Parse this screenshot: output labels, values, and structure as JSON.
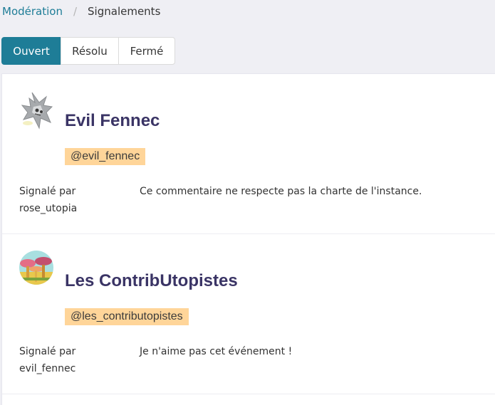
{
  "breadcrumb": {
    "parent": "Modération",
    "separator": "/",
    "current": "Signalements"
  },
  "tabs": [
    {
      "label": "Ouvert",
      "active": true
    },
    {
      "label": "Résolu",
      "active": false
    },
    {
      "label": "Fermé",
      "active": false
    }
  ],
  "reports": [
    {
      "display_name": "Evil Fennec",
      "handle": "@evil_fennec",
      "reported_by_label": "Signalé par",
      "reporter": "rose_utopia",
      "comment": "Ce commentaire ne respecte pas la charte de l'instance.",
      "avatar_icon": "fennec-avatar-icon"
    },
    {
      "display_name": "Les ContribUtopistes",
      "handle": "@les_contributopistes",
      "reported_by_label": "Signalé par",
      "reporter": "evil_fennec",
      "comment": "Je n'aime pas cet événement !",
      "avatar_icon": "mushroom-avatar-icon"
    }
  ],
  "colors": {
    "accent": "#1e7d97",
    "name": "#3a3465",
    "handle_bg": "#ffd599"
  }
}
